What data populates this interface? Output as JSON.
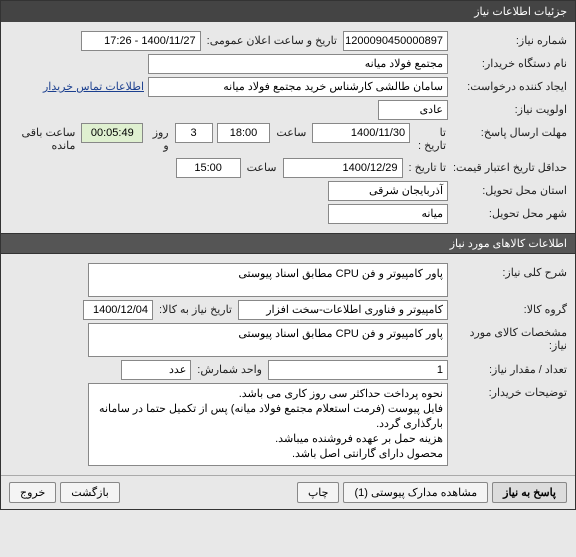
{
  "dialog": {
    "title": "جزئیات اطلاعات نیاز"
  },
  "need": {
    "number_label": "شماره نیاز:",
    "number": "1200090450000897",
    "announce_label": "تاریخ و ساعت اعلان عمومی:",
    "announce": "1400/11/27 - 17:26",
    "buyer_label": "نام دستگاه خریدار:",
    "buyer": "مجتمع فولاد میانه",
    "creator_label": "ایجاد کننده درخواست:",
    "creator": "سامان طالشی کارشناس خرید مجتمع فولاد میانه",
    "contact_link": "اطلاعات تماس خریدار",
    "priority_label": "اولویت نیاز:",
    "priority": "عادی",
    "deadline_label": "مهلت ارسال پاسخ:",
    "deadline_to": "تا تاریخ :",
    "deadline_date": "1400/11/30",
    "time_label": "ساعت",
    "deadline_time": "18:00",
    "days_and": "روز و",
    "days": "3",
    "remaining_time": "00:05:49",
    "remaining_label": "ساعت باقی مانده",
    "validity_label": "حداقل تاریخ اعتبار قیمت:",
    "validity_to": "تا تاریخ :",
    "validity_date": "1400/12/29",
    "validity_time": "15:00",
    "province_label": "استان محل تحویل:",
    "province": "آذربایجان شرقی",
    "city_label": "شهر محل تحویل:",
    "city": "میانه"
  },
  "goods": {
    "header": "اطلاعات کالاهای مورد نیاز",
    "desc_label": "شرح کلی نیاز:",
    "desc": "پاور کامپیوتر و فن CPU مطابق اسناد پیوستی",
    "group_label": "گروه کالا:",
    "group": "کامپیوتر و فناوری اطلاعات-سخت افزار",
    "need_date_label": "تاریخ نیاز به کالا:",
    "need_date": "1400/12/04",
    "spec_label": "مشخصات کالای مورد نیاز:",
    "spec": "پاور کامپیوتر و فن CPU مطابق اسناد پیوستی",
    "qty_label": "تعداد / مقدار نیاز:",
    "qty": "1",
    "unit_label": "واحد شمارش:",
    "unit": "عدد",
    "notes_label": "توضیحات خریدار:",
    "notes": "نحوه پرداخت حداکثر سی روز کاری می باشد.\nفایل پیوست (فرمت استعلام مجتمع فولاد میانه) پس از تکمیل حتما در سامانه بارگذاری گردد.\nهزینه حمل بر عهده فروشنده میباشد.\nمحصول دارای گارانتی اصل باشد."
  },
  "footer": {
    "respond": "پاسخ به نیاز",
    "attachments": "مشاهده مدارک پیوستی (1)",
    "print": "چاپ",
    "back": "بازگشت",
    "exit": "خروج"
  }
}
